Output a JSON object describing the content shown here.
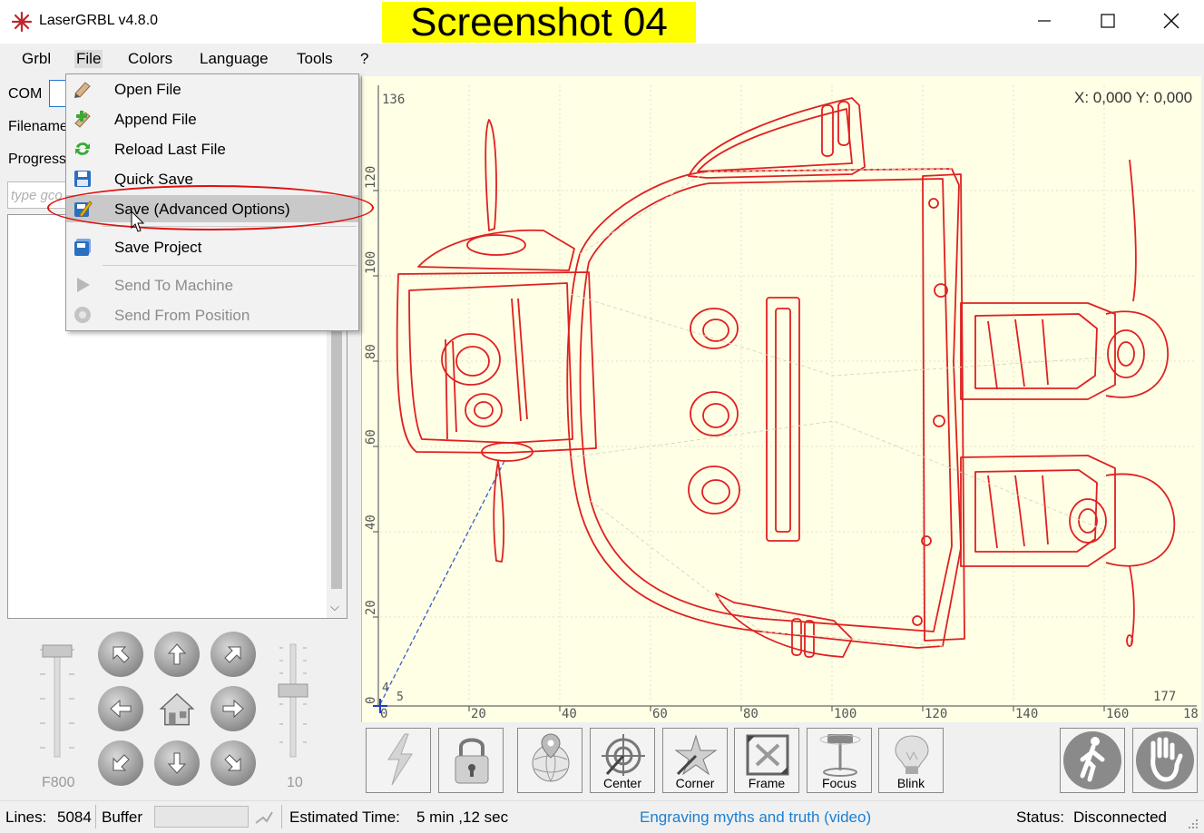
{
  "window": {
    "title": "LaserGRBL v4.8.0",
    "overlay_label": "Screenshot 04"
  },
  "menubar": {
    "items": [
      "Grbl",
      "File",
      "Colors",
      "Language",
      "Tools",
      "?"
    ]
  },
  "file_menu": {
    "items": [
      {
        "label": "Open File",
        "icon": "open-file-icon",
        "enabled": true
      },
      {
        "label": "Append File",
        "icon": "append-file-icon",
        "enabled": true
      },
      {
        "label": "Reload Last File",
        "icon": "reload-icon",
        "enabled": true
      },
      {
        "label": "Quick Save",
        "icon": "floppy-disk-icon",
        "enabled": true
      },
      {
        "label": "Save (Advanced Options)",
        "icon": "save-advanced-icon",
        "enabled": true,
        "highlighted": true
      },
      {
        "label": "Save Project",
        "icon": "save-project-icon",
        "enabled": true
      },
      {
        "label": "Send To Machine",
        "icon": "play-icon",
        "enabled": false
      },
      {
        "label": "Send From Position",
        "icon": "send-from-position-icon",
        "enabled": false
      }
    ]
  },
  "left_panel": {
    "com_label": "COM",
    "filename_label": "Filename",
    "progress_label": "Progress",
    "gcode_placeholder": "type gco",
    "feed_slider_value": "F800",
    "step_slider_value": "10"
  },
  "canvas": {
    "coords": "X: 0,000 Y: 0,000",
    "y_max_label": "136",
    "x_max_label": "177",
    "origin_x_label": "5",
    "origin_y_label": "4",
    "x_ticks": [
      "0",
      "20",
      "40",
      "60",
      "80",
      "100",
      "120",
      "140",
      "160",
      "18"
    ],
    "y_ticks": [
      "0",
      "20",
      "40",
      "60",
      "80",
      "100",
      "120"
    ],
    "background": "#ffffe6",
    "path_color": "#e02020"
  },
  "toolbar": {
    "buttons": [
      {
        "label": "",
        "icon": "laser-bolt-icon"
      },
      {
        "label": "",
        "icon": "padlock-icon"
      },
      {
        "label": "",
        "icon": "globe-location-icon"
      },
      {
        "label": "Center",
        "icon": "center-icon"
      },
      {
        "label": "Corner",
        "icon": "corner-icon"
      },
      {
        "label": "Frame",
        "icon": "frame-icon"
      },
      {
        "label": "Focus",
        "icon": "focus-icon"
      },
      {
        "label": "Blink",
        "icon": "bulb-icon"
      }
    ],
    "walk_icon": "walking-person-icon",
    "stop_icon": "stop-hand-icon"
  },
  "statusbar": {
    "lines_label": "Lines:",
    "lines_value": "5084",
    "buffer_label": "Buffer",
    "estimated_label": "Estimated Time:",
    "estimated_value": "5 min ,12 sec",
    "link_text": "Engraving myths and truth (video)",
    "link_color": "#1a7fd4",
    "status_label": "Status:",
    "status_value": "Disconnected"
  }
}
